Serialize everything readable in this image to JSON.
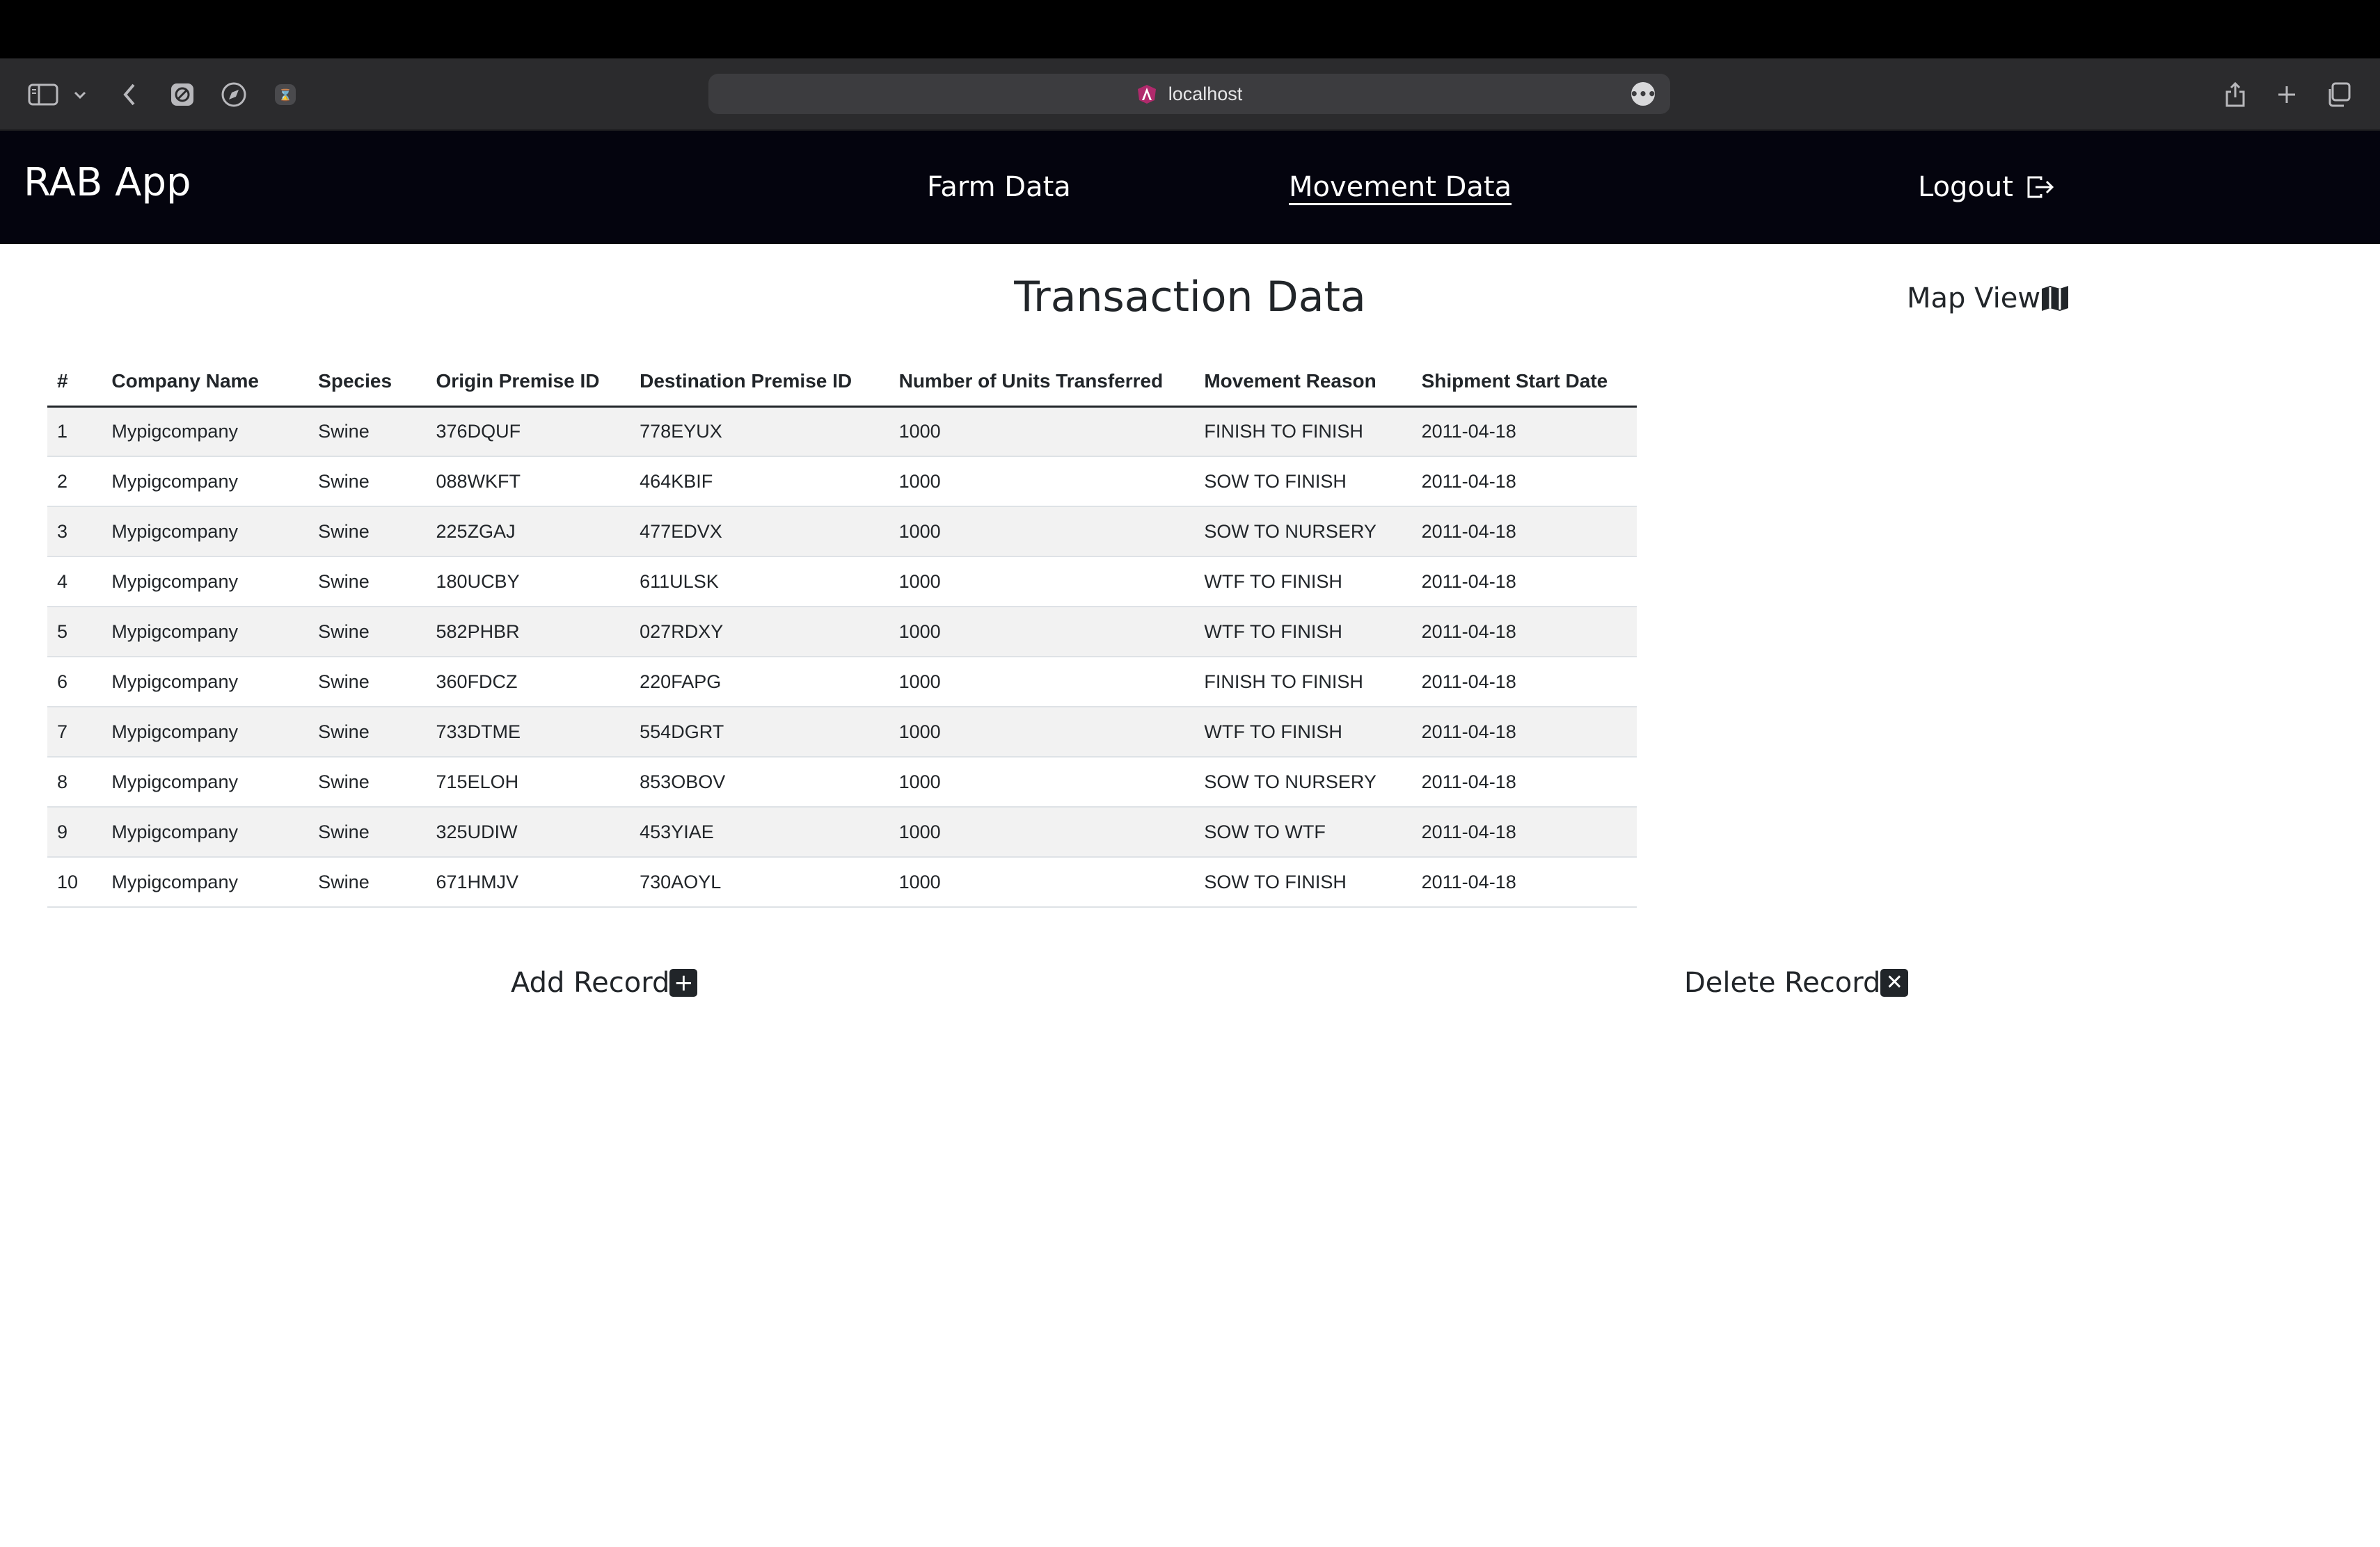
{
  "browser": {
    "url": "localhost"
  },
  "app": {
    "brand": "RAB App",
    "nav": {
      "farm_data": "Farm Data",
      "movement_data": "Movement Data",
      "logout": "Logout"
    }
  },
  "page": {
    "title": "Transaction Data",
    "map_view": "Map View",
    "add_record": "Add Record",
    "delete_record": "Delete Record"
  },
  "table": {
    "headers": [
      "#",
      "Company Name",
      "Species",
      "Origin Premise ID",
      "Destination Premise ID",
      "Number of Units Transferred",
      "Movement Reason",
      "Shipment Start Date"
    ],
    "rows": [
      [
        "1",
        "Mypigcompany",
        "Swine",
        "376DQUF",
        "778EYUX",
        "1000",
        "FINISH TO FINISH",
        "2011-04-18"
      ],
      [
        "2",
        "Mypigcompany",
        "Swine",
        "088WKFT",
        "464KBIF",
        "1000",
        "SOW TO FINISH",
        "2011-04-18"
      ],
      [
        "3",
        "Mypigcompany",
        "Swine",
        "225ZGAJ",
        "477EDVX",
        "1000",
        "SOW TO NURSERY",
        "2011-04-18"
      ],
      [
        "4",
        "Mypigcompany",
        "Swine",
        "180UCBY",
        "611ULSK",
        "1000",
        "WTF TO FINISH",
        "2011-04-18"
      ],
      [
        "5",
        "Mypigcompany",
        "Swine",
        "582PHBR",
        "027RDXY",
        "1000",
        "WTF TO FINISH",
        "2011-04-18"
      ],
      [
        "6",
        "Mypigcompany",
        "Swine",
        "360FDCZ",
        "220FAPG",
        "1000",
        "FINISH TO FINISH",
        "2011-04-18"
      ],
      [
        "7",
        "Mypigcompany",
        "Swine",
        "733DTME",
        "554DGRT",
        "1000",
        "WTF TO FINISH",
        "2011-04-18"
      ],
      [
        "8",
        "Mypigcompany",
        "Swine",
        "715ELOH",
        "853OBOV",
        "1000",
        "SOW TO NURSERY",
        "2011-04-18"
      ],
      [
        "9",
        "Mypigcompany",
        "Swine",
        "325UDIW",
        "453YIAE",
        "1000",
        "SOW TO WTF",
        "2011-04-18"
      ],
      [
        "10",
        "Mypigcompany",
        "Swine",
        "671HMJV",
        "730AOYL",
        "1000",
        "SOW TO FINISH",
        "2011-04-18"
      ]
    ]
  },
  "icons": {
    "sidebar": "sidebar-icon",
    "back": "chevron-left-icon",
    "logout": "logout-icon",
    "map": "map-icon",
    "add": "plus-square-icon",
    "delete": "x-square-icon"
  }
}
